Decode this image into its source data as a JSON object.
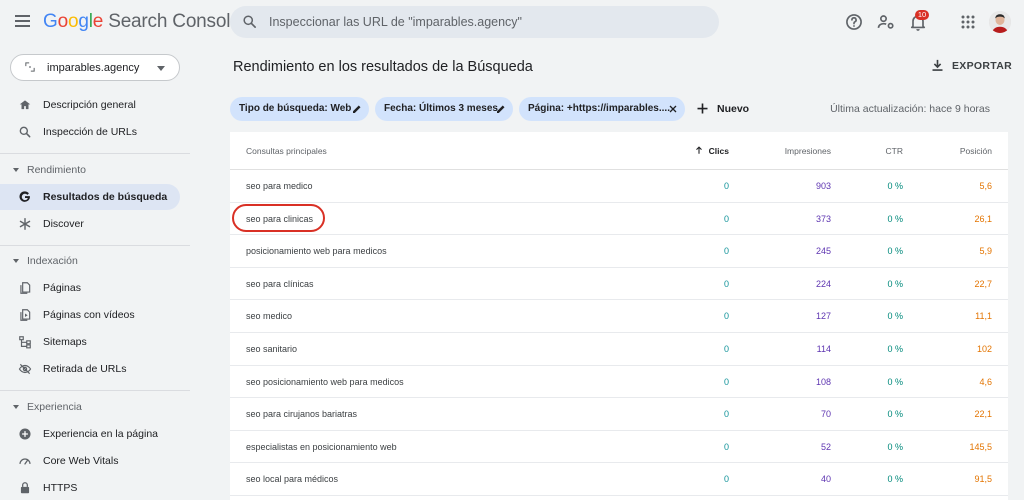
{
  "header": {
    "logo_google": [
      "G",
      "o",
      "o",
      "g",
      "l",
      "e"
    ],
    "logo_rest": "Search Console",
    "search_placeholder": "Inspeccionar las URL de \"imparables.agency\"",
    "notification_count": "10"
  },
  "sidebar": {
    "property": "imparables.agency",
    "items_top": [
      {
        "label": "Descripción general",
        "icon": "home-icon"
      },
      {
        "label": "Inspección de URLs",
        "icon": "search-icon"
      }
    ],
    "sections": [
      {
        "label": "Rendimiento",
        "items": [
          {
            "label": "Resultados de búsqueda",
            "icon": "google-g-icon",
            "active": true
          },
          {
            "label": "Discover",
            "icon": "asterisk-icon"
          }
        ]
      },
      {
        "label": "Indexación",
        "items": [
          {
            "label": "Páginas",
            "icon": "pages-icon"
          },
          {
            "label": "Páginas con vídeos",
            "icon": "video-pages-icon"
          },
          {
            "label": "Sitemaps",
            "icon": "sitemap-icon"
          },
          {
            "label": "Retirada de URLs",
            "icon": "eye-off-icon"
          }
        ]
      },
      {
        "label": "Experiencia",
        "items": [
          {
            "label": "Experiencia en la página",
            "icon": "plus-circle-icon"
          },
          {
            "label": "Core Web Vitals",
            "icon": "gauge-icon"
          },
          {
            "label": "HTTPS",
            "icon": "lock-icon"
          }
        ]
      }
    ]
  },
  "main": {
    "title": "Rendimiento en los resultados de la Búsqueda",
    "export_label": "EXPORTAR",
    "filters": [
      {
        "label": "Tipo de búsqueda: Web",
        "action": "edit"
      },
      {
        "label": "Fecha: Últimos 3 meses",
        "action": "edit"
      },
      {
        "label": "Página: +https://imparables....",
        "action": "remove"
      }
    ],
    "new_filter_label": "Nuevo",
    "last_update": "Última actualización: hace 9 horas"
  },
  "table": {
    "columns": [
      "Consultas principales",
      "Clics",
      "Impresiones",
      "CTR",
      "Posición"
    ],
    "sorted_column": "Clics",
    "rows": [
      {
        "query": "seo para medico",
        "clicks": "0",
        "impressions": "903",
        "ctr": "0 %",
        "position": "5,6"
      },
      {
        "query": "seo para clinicas",
        "clicks": "0",
        "impressions": "373",
        "ctr": "0 %",
        "position": "26,1"
      },
      {
        "query": "posicionamiento web para medicos",
        "clicks": "0",
        "impressions": "245",
        "ctr": "0 %",
        "position": "5,9"
      },
      {
        "query": "seo para clínicas",
        "clicks": "0",
        "impressions": "224",
        "ctr": "0 %",
        "position": "22,7"
      },
      {
        "query": "seo medico",
        "clicks": "0",
        "impressions": "127",
        "ctr": "0 %",
        "position": "11,1"
      },
      {
        "query": "seo sanitario",
        "clicks": "0",
        "impressions": "114",
        "ctr": "0 %",
        "position": "102"
      },
      {
        "query": "seo posicionamiento web para medicos",
        "clicks": "0",
        "impressions": "108",
        "ctr": "0 %",
        "position": "4,6"
      },
      {
        "query": "seo para cirujanos bariatras",
        "clicks": "0",
        "impressions": "70",
        "ctr": "0 %",
        "position": "22,1"
      },
      {
        "query": "especialistas en posicionamiento web",
        "clicks": "0",
        "impressions": "52",
        "ctr": "0 %",
        "position": "145,5"
      },
      {
        "query": "seo local para médicos",
        "clicks": "0",
        "impressions": "40",
        "ctr": "0 %",
        "position": "91,5"
      }
    ],
    "highlighted_row": 1
  },
  "colors": {
    "clicks": "#12939a",
    "impressions": "#5e35b1",
    "ctr": "#00897b",
    "position": "#e37400",
    "highlight": "#d93025",
    "chip": "#d2e3fc",
    "active_nav": "#dde5f3"
  }
}
